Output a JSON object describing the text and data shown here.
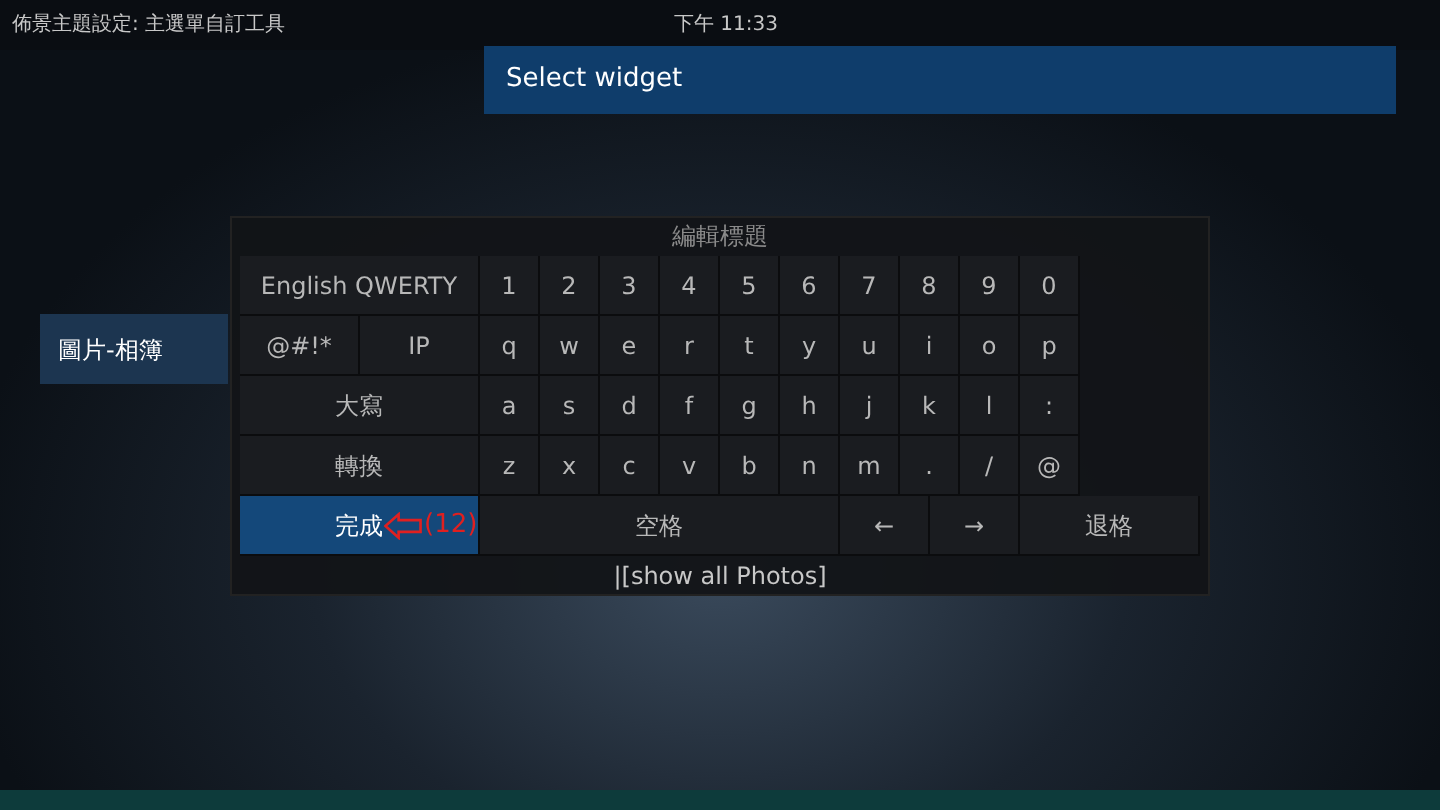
{
  "top_bar": {
    "title": "佈景主題設定: 主選單自訂工具",
    "clock": "下午 11:33"
  },
  "header": {
    "title": "Select widget"
  },
  "sidebar": {
    "items": [
      {
        "label": "圖片-相簿",
        "selected": true
      }
    ]
  },
  "keyboard": {
    "title": "編輯標題",
    "rows": [
      {
        "side_keys": [
          {
            "label": "English QWERTY",
            "kind": "mode",
            "selected": false
          }
        ],
        "keys": [
          {
            "label": "1",
            "kind": "char",
            "selected": false
          },
          {
            "label": "2",
            "kind": "char",
            "selected": false
          },
          {
            "label": "3",
            "kind": "char",
            "selected": false
          },
          {
            "label": "4",
            "kind": "char",
            "selected": false
          },
          {
            "label": "5",
            "kind": "char",
            "selected": false
          },
          {
            "label": "6",
            "kind": "char",
            "selected": false
          },
          {
            "label": "7",
            "kind": "char",
            "selected": false
          },
          {
            "label": "8",
            "kind": "char",
            "selected": false
          },
          {
            "label": "9",
            "kind": "char",
            "selected": false
          },
          {
            "label": "0",
            "kind": "char",
            "selected": false
          }
        ]
      },
      {
        "side_keys": [
          {
            "label": "@#!*",
            "kind": "half",
            "selected": false
          },
          {
            "label": "IP",
            "kind": "half",
            "selected": false
          }
        ],
        "keys": [
          {
            "label": "q",
            "kind": "char",
            "selected": false
          },
          {
            "label": "w",
            "kind": "char",
            "selected": false
          },
          {
            "label": "e",
            "kind": "char",
            "selected": false
          },
          {
            "label": "r",
            "kind": "char",
            "selected": false
          },
          {
            "label": "t",
            "kind": "char",
            "selected": false
          },
          {
            "label": "y",
            "kind": "char",
            "selected": false
          },
          {
            "label": "u",
            "kind": "char",
            "selected": false
          },
          {
            "label": "i",
            "kind": "char",
            "selected": false
          },
          {
            "label": "o",
            "kind": "char",
            "selected": false
          },
          {
            "label": "p",
            "kind": "char",
            "selected": false
          }
        ]
      },
      {
        "side_keys": [
          {
            "label": "大寫",
            "kind": "mode",
            "selected": false
          }
        ],
        "keys": [
          {
            "label": "a",
            "kind": "char",
            "selected": false
          },
          {
            "label": "s",
            "kind": "char",
            "selected": false
          },
          {
            "label": "d",
            "kind": "char",
            "selected": false
          },
          {
            "label": "f",
            "kind": "char",
            "selected": false
          },
          {
            "label": "g",
            "kind": "char",
            "selected": false
          },
          {
            "label": "h",
            "kind": "char",
            "selected": false
          },
          {
            "label": "j",
            "kind": "char",
            "selected": false
          },
          {
            "label": "k",
            "kind": "char",
            "selected": false
          },
          {
            "label": "l",
            "kind": "char",
            "selected": false
          },
          {
            "label": ":",
            "kind": "char",
            "selected": false
          }
        ]
      },
      {
        "side_keys": [
          {
            "label": "轉換",
            "kind": "mode",
            "selected": false
          }
        ],
        "keys": [
          {
            "label": "z",
            "kind": "char",
            "selected": false
          },
          {
            "label": "x",
            "kind": "char",
            "selected": false
          },
          {
            "label": "c",
            "kind": "char",
            "selected": false
          },
          {
            "label": "v",
            "kind": "char",
            "selected": false
          },
          {
            "label": "b",
            "kind": "char",
            "selected": false
          },
          {
            "label": "n",
            "kind": "char",
            "selected": false
          },
          {
            "label": "m",
            "kind": "char",
            "selected": false
          },
          {
            "label": ".",
            "kind": "char",
            "selected": false
          },
          {
            "label": "/",
            "kind": "char",
            "selected": false
          },
          {
            "label": "@",
            "kind": "char",
            "selected": false
          }
        ]
      },
      {
        "side_keys": [
          {
            "label": "完成",
            "kind": "mode",
            "selected": true,
            "annotation": "(12)"
          }
        ],
        "keys": [
          {
            "label": "空格",
            "kind": "space",
            "selected": false
          },
          {
            "label": "←",
            "kind": "arrow",
            "selected": false
          },
          {
            "label": "→",
            "kind": "arrow",
            "selected": false
          },
          {
            "label": "退格",
            "kind": "backspace",
            "selected": false
          }
        ]
      }
    ],
    "value": "|[show all Photos]"
  }
}
